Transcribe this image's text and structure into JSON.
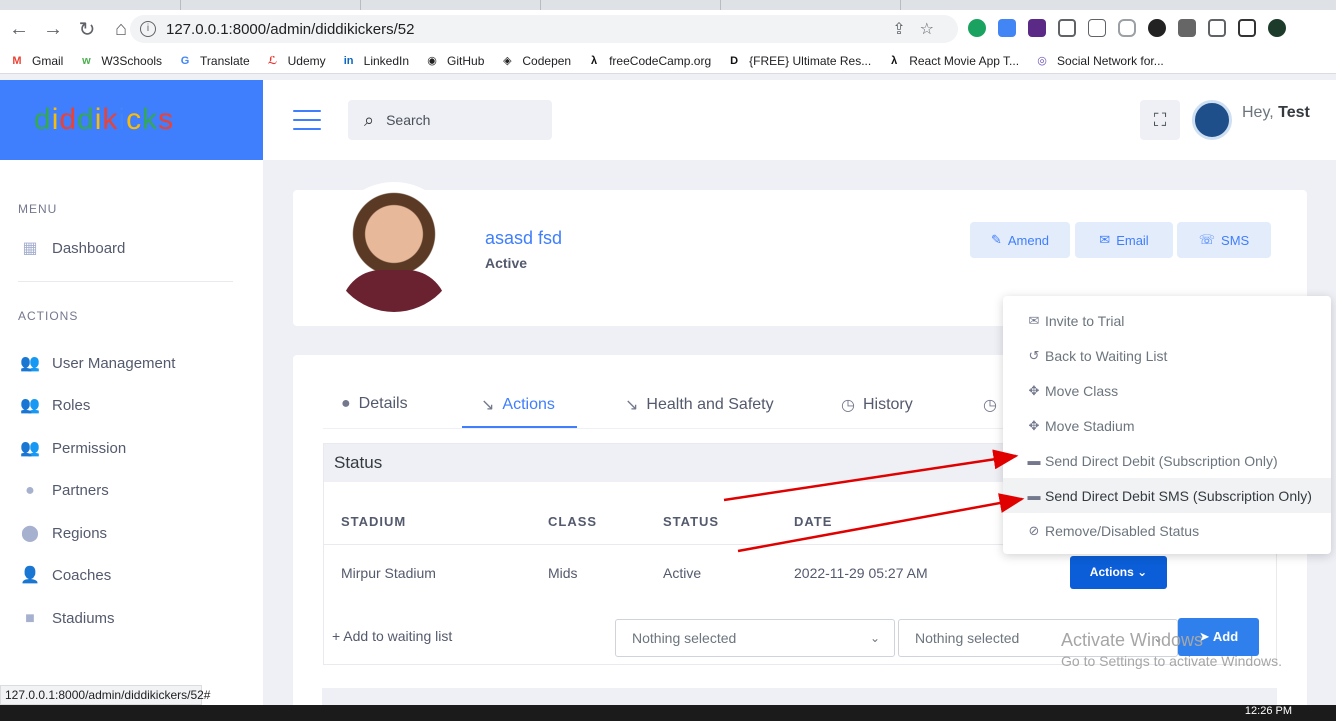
{
  "browser": {
    "url": "127.0.0.1:8000/admin/diddikickers/52",
    "bookmarks": [
      {
        "label": "Gmail"
      },
      {
        "label": "W3Schools"
      },
      {
        "label": "Translate"
      },
      {
        "label": "Udemy"
      },
      {
        "label": "LinkedIn"
      },
      {
        "label": "GitHub"
      },
      {
        "label": "Codepen"
      },
      {
        "label": "freeCodeCamp.org"
      },
      {
        "label": "{FREE} Ultimate Res..."
      },
      {
        "label": "React Movie App T..."
      },
      {
        "label": "Social Network for..."
      }
    ],
    "status_url": "127.0.0.1:8000/admin/diddikickers/52#"
  },
  "brand": {
    "logo_text": "diddikicks"
  },
  "topbar": {
    "search_placeholder": "Search",
    "greeting": "Hey,",
    "user_name": "Test"
  },
  "sidebar": {
    "menu_title": "MENU",
    "menu_items": [
      {
        "label": "Dashboard",
        "icon": "dashboard-icon"
      }
    ],
    "actions_title": "ACTIONS",
    "action_items": [
      {
        "label": "User Management",
        "icon": "users-icon"
      },
      {
        "label": "Roles",
        "icon": "users-icon"
      },
      {
        "label": "Permission",
        "icon": "users-icon"
      },
      {
        "label": "Partners",
        "icon": "user-circle-icon"
      },
      {
        "label": "Regions",
        "icon": "map-pin-icon"
      },
      {
        "label": "Coaches",
        "icon": "user-icon"
      },
      {
        "label": "Stadiums",
        "icon": "square-icon"
      }
    ]
  },
  "profile": {
    "name": "asasd fsd",
    "status": "Active",
    "buttons": {
      "amend": "Amend",
      "email": "Email",
      "sms": "SMS"
    }
  },
  "tabs": [
    {
      "label": "Details"
    },
    {
      "label": "Actions"
    },
    {
      "label": "Health and Safety"
    },
    {
      "label": "History"
    }
  ],
  "status_section": {
    "title": "Status",
    "columns": [
      "STADIUM",
      "CLASS",
      "STATUS",
      "DATE"
    ],
    "row": {
      "stadium": "Mirpur Stadium",
      "class": "Mids",
      "status": "Active",
      "date": "2022-11-29 05:27 AM"
    },
    "actions_button": "Actions",
    "add_waiting": "Add to waiting list",
    "select1": "Nothing selected",
    "select2": "Nothing selected",
    "add_button": "Add"
  },
  "dropdown": [
    {
      "label": "Invite to Trial",
      "icon": "envelope-icon"
    },
    {
      "label": "Back to Waiting List",
      "icon": "undo-icon"
    },
    {
      "label": "Move Class",
      "icon": "move-icon"
    },
    {
      "label": "Move Stadium",
      "icon": "move-icon"
    },
    {
      "label": "Send Direct Debit (Subscription Only)",
      "icon": "credit-card-icon"
    },
    {
      "label": "Send Direct Debit SMS (Subscription Only)",
      "icon": "credit-card-icon"
    },
    {
      "label": "Remove/Disabled Status",
      "icon": "ban-icon"
    }
  ],
  "watermark": {
    "line1": "Activate Windows",
    "line2": "Go to Settings to activate Windows."
  },
  "taskbar": {
    "time": "12:26 PM"
  },
  "colors": {
    "primary": "#3f7efc",
    "actions_button": "#0b5ed7",
    "annotation_arrow": "#e00000"
  }
}
